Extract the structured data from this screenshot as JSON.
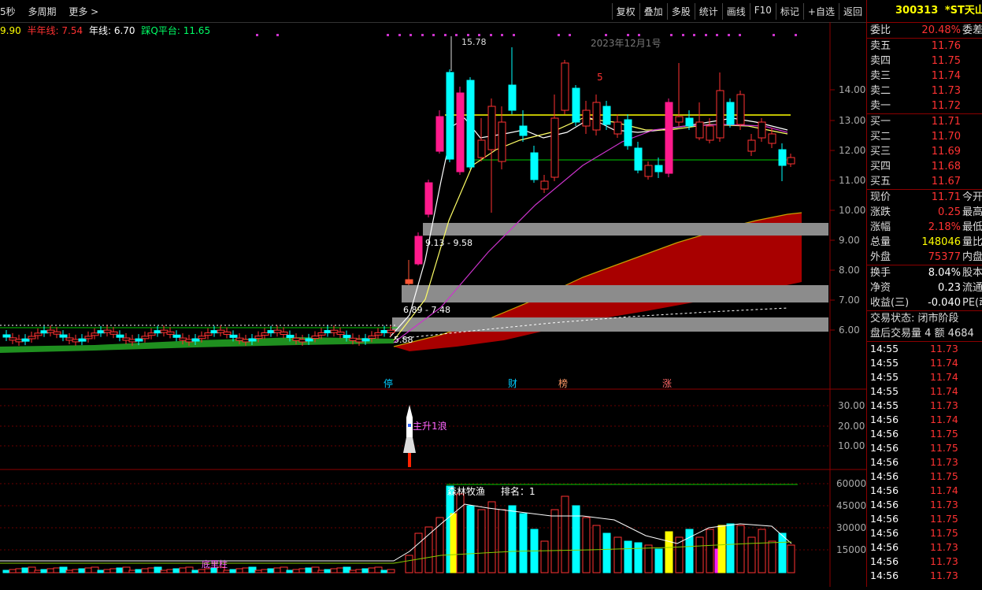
{
  "topbar": {
    "left_items": [
      "5秒",
      "多周期",
      "更多 >"
    ],
    "buttons": [
      "复权",
      "叠加",
      "多股",
      "统计",
      "画线",
      "F10",
      "标记",
      "+自选",
      "返回"
    ]
  },
  "indicators": {
    "ma1": "9.90",
    "half_year_label": "半年线:",
    "half_year_value": "7.54",
    "year_label": "年线:",
    "year_value": "6.70",
    "platform_label": "踩Q平台:",
    "platform_value": "11.65"
  },
  "chart": {
    "date_label": "2023年12月1号",
    "high_label": "15.78",
    "range1": "9.13 - 9.58",
    "range2": "6.89 - 7.48",
    "low_label": "5.88",
    "wave_label": "5",
    "y_ticks": [
      "14.00",
      "13.00",
      "12.00",
      "11.00",
      "10.00",
      "9.00",
      "8.00",
      "7.00",
      "6.00"
    ],
    "markers": [
      "停",
      "财",
      "榜",
      "涨"
    ],
    "mid_ticks": [
      "30.00",
      "20.00",
      "10.00"
    ],
    "mid_label": "主升1浪",
    "vol_ticks": [
      "60000",
      "45000",
      "30000",
      "15000"
    ],
    "vol_label": "森林牧渔",
    "rank_label": "排名：1",
    "bottom_label": "底里柱"
  },
  "quote": {
    "code": "300313",
    "name": "*ST天山",
    "weibi_label": "委比",
    "weibi_value": "20.48%",
    "weicha_label": "委差",
    "asks": [
      {
        "label": "卖五",
        "price": "11.76"
      },
      {
        "label": "卖四",
        "price": "11.75"
      },
      {
        "label": "卖三",
        "price": "11.74"
      },
      {
        "label": "卖二",
        "price": "11.73"
      },
      {
        "label": "卖一",
        "price": "11.72"
      }
    ],
    "bids": [
      {
        "label": "买一",
        "price": "11.71"
      },
      {
        "label": "买二",
        "price": "11.70"
      },
      {
        "label": "买三",
        "price": "11.69"
      },
      {
        "label": "买四",
        "price": "11.68"
      },
      {
        "label": "买五",
        "price": "11.67"
      }
    ],
    "stats": [
      {
        "label": "现价",
        "value": "11.71",
        "ext": "今开"
      },
      {
        "label": "涨跌",
        "value": "0.25",
        "ext": "最高"
      },
      {
        "label": "涨幅",
        "value": "2.18%",
        "ext": "最低"
      },
      {
        "label": "总量",
        "value": "148046",
        "ext": "量比"
      },
      {
        "label": "外盘",
        "value": "75377",
        "ext": "内盘"
      }
    ],
    "stats2": [
      {
        "label": "换手",
        "value": "8.04%",
        "ext": "股本"
      },
      {
        "label": "净资",
        "value": "0.23",
        "ext": "流通"
      },
      {
        "label": "收益(三)",
        "value": "-0.040",
        "ext": "PE(动"
      }
    ],
    "trade_status": "交易状态: 闭市阶段",
    "after_hours": "盘后交易量 4 额 4684"
  },
  "ticks": [
    {
      "time": "14:55",
      "price": "11.73"
    },
    {
      "time": "14:55",
      "price": "11.74"
    },
    {
      "time": "14:55",
      "price": "11.74"
    },
    {
      "time": "14:55",
      "price": "11.74"
    },
    {
      "time": "14:55",
      "price": "11.73"
    },
    {
      "time": "14:56",
      "price": "11.74"
    },
    {
      "time": "14:56",
      "price": "11.75"
    },
    {
      "time": "14:56",
      "price": "11.75"
    },
    {
      "time": "14:56",
      "price": "11.73"
    },
    {
      "time": "14:56",
      "price": "11.75"
    },
    {
      "time": "14:56",
      "price": "11.74"
    },
    {
      "time": "14:56",
      "price": "11.73"
    },
    {
      "time": "14:56",
      "price": "11.75"
    },
    {
      "time": "14:56",
      "price": "11.75"
    },
    {
      "time": "14:56",
      "price": "11.73"
    },
    {
      "time": "14:56",
      "price": "11.73"
    },
    {
      "time": "14:56",
      "price": "11.73"
    }
  ]
}
